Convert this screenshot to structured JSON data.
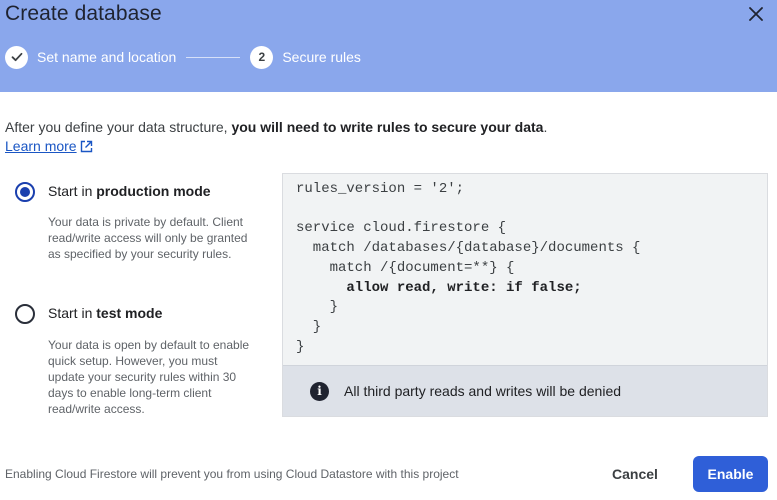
{
  "dialog": {
    "title": "Create database",
    "close_icon": "close-icon"
  },
  "stepper": {
    "steps": [
      {
        "label": "Set name and location",
        "marker": "✓",
        "state": "complete"
      },
      {
        "label": "Secure rules",
        "marker": "2",
        "state": "current"
      }
    ]
  },
  "intro": {
    "text": "After you define your data structure, ",
    "bold": "you will need to write rules to secure your data",
    "end": ".",
    "learn_more": "Learn more",
    "learn_more_icon": "external-link-icon"
  },
  "options": [
    {
      "prefix": "Start in ",
      "mode": "production mode",
      "selected": true,
      "description": "Your data is private by default. Client read/write access will only be granted as specified by your security rules."
    },
    {
      "prefix": "Start in ",
      "mode": "test mode",
      "selected": false,
      "description": "Your data is open by default to enable quick setup. However, you must update your security rules within 30 days to enable long-term client read/write access."
    }
  ],
  "rules": {
    "lines": [
      "rules_version = '2';",
      "",
      "service cloud.firestore {",
      "  match /databases/{database}/documents {",
      "    match /{document=**} {",
      "      allow read, write: if false;",
      "    }",
      "  }",
      "}"
    ],
    "notice": "All third party reads and writes will be denied",
    "notice_icon": "info-icon"
  },
  "footer": {
    "note": "Enabling Cloud Firestore will prevent you from using Cloud Datastore with this project",
    "cancel_label": "Cancel",
    "enable_label": "Enable"
  },
  "colors": {
    "header": "#8aa7ec",
    "primary": "#2f5fd8",
    "link": "#1a56c4"
  }
}
